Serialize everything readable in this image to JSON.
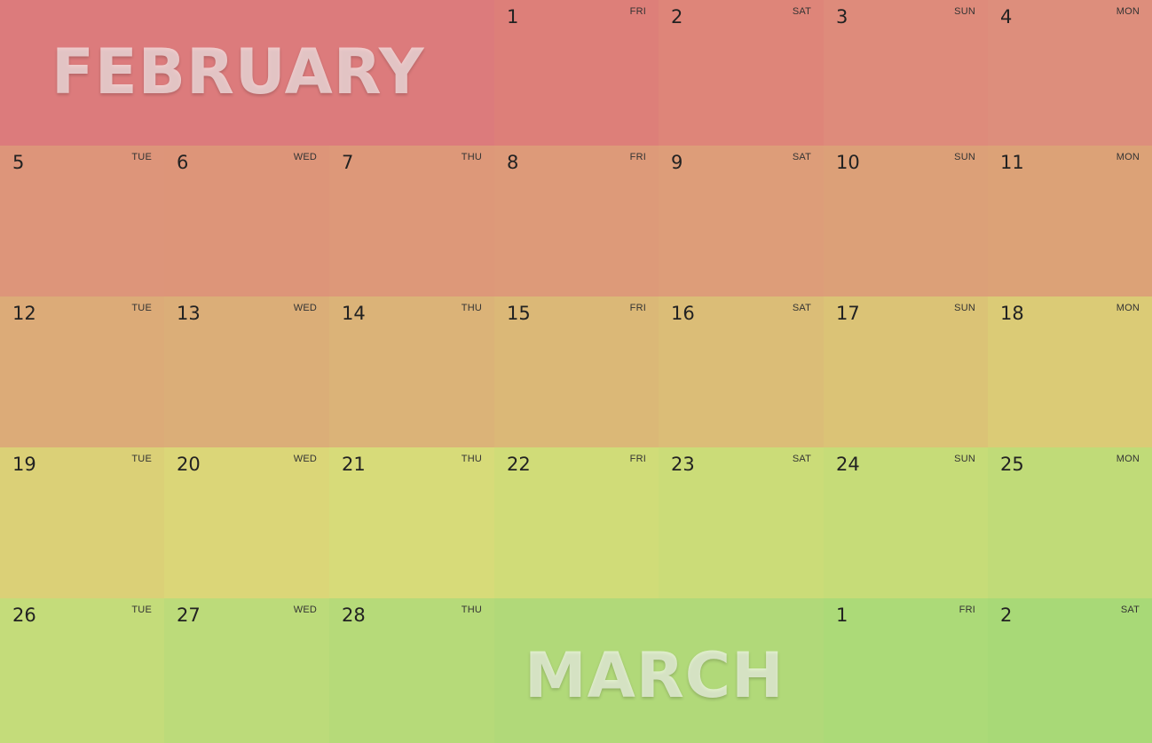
{
  "months": {
    "first": "FEBRUARY",
    "second": "MARCH"
  },
  "cells": [
    {
      "day": "",
      "dow": "",
      "color": "#dc7b7c"
    },
    {
      "day": "",
      "dow": "",
      "color": "#dc7b7c"
    },
    {
      "day": "",
      "dow": "",
      "color": "#dc7b7c"
    },
    {
      "day": "1",
      "dow": "FRI",
      "color": "#dd7f79"
    },
    {
      "day": "2",
      "dow": "SAT",
      "color": "#de8579"
    },
    {
      "day": "3",
      "dow": "SUN",
      "color": "#de8b7b"
    },
    {
      "day": "4",
      "dow": "MON",
      "color": "#dd8e7c"
    },
    {
      "day": "5",
      "dow": "TUE",
      "color": "#dd957a"
    },
    {
      "day": "6",
      "dow": "WED",
      "color": "#dd9579"
    },
    {
      "day": "7",
      "dow": "THU",
      "color": "#dd9879"
    },
    {
      "day": "8",
      "dow": "FRI",
      "color": "#dd9a79"
    },
    {
      "day": "9",
      "dow": "SAT",
      "color": "#dd9d79"
    },
    {
      "day": "10",
      "dow": "SUN",
      "color": "#dca078"
    },
    {
      "day": "11",
      "dow": "MON",
      "color": "#dca277"
    },
    {
      "day": "12",
      "dow": "TUE",
      "color": "#dcab78"
    },
    {
      "day": "13",
      "dow": "WED",
      "color": "#dbae78"
    },
    {
      "day": "14",
      "dow": "THU",
      "color": "#dbb378"
    },
    {
      "day": "15",
      "dow": "FRI",
      "color": "#dbb877"
    },
    {
      "day": "16",
      "dow": "SAT",
      "color": "#dbbd77"
    },
    {
      "day": "17",
      "dow": "SUN",
      "color": "#dbc376"
    },
    {
      "day": "18",
      "dow": "MON",
      "color": "#dbcb76"
    },
    {
      "day": "19",
      "dow": "TUE",
      "color": "#dbd077"
    },
    {
      "day": "20",
      "dow": "WED",
      "color": "#dbd678"
    },
    {
      "day": "21",
      "dow": "THU",
      "color": "#d7db79"
    },
    {
      "day": "22",
      "dow": "FRI",
      "color": "#d0dc78"
    },
    {
      "day": "23",
      "dow": "SAT",
      "color": "#cbdc78"
    },
    {
      "day": "24",
      "dow": "SUN",
      "color": "#c6dc78"
    },
    {
      "day": "25",
      "dow": "MON",
      "color": "#c0db78"
    },
    {
      "day": "26",
      "dow": "TUE",
      "color": "#c4dc7a"
    },
    {
      "day": "27",
      "dow": "WED",
      "color": "#bcdb7a"
    },
    {
      "day": "28",
      "dow": "THU",
      "color": "#b6da79"
    },
    {
      "day": "",
      "dow": "",
      "color": "#b1d979"
    },
    {
      "day": "",
      "dow": "",
      "color": "#b1d979"
    },
    {
      "day": "1",
      "dow": "FRI",
      "color": "#acda78"
    },
    {
      "day": "2",
      "dow": "SAT",
      "color": "#a8d977"
    }
  ]
}
